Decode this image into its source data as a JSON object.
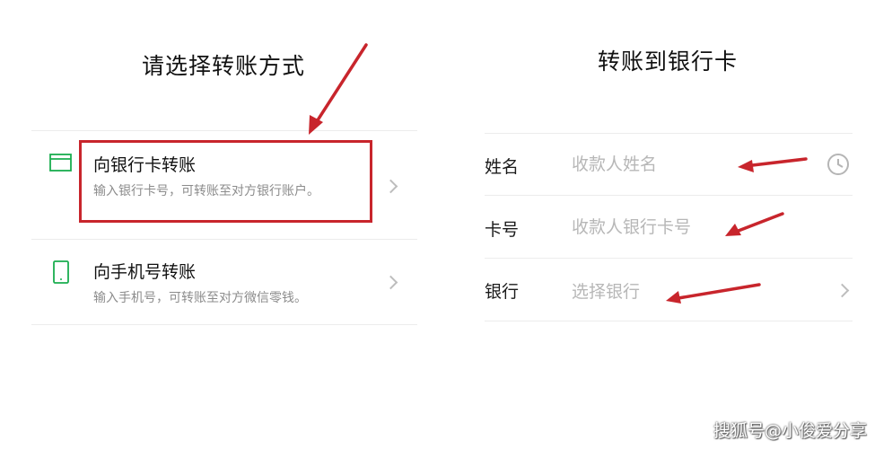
{
  "left_panel": {
    "title": "请选择转账方式",
    "options": [
      {
        "title": "向银行卡转账",
        "description": "输入银行卡号，可转账至对方银行账户。",
        "icon": "bank-card-icon"
      },
      {
        "title": "向手机号转账",
        "description": "输入手机号，可转账至对方微信零钱。",
        "icon": "phone-icon"
      }
    ]
  },
  "right_panel": {
    "title": "转账到银行卡",
    "fields": [
      {
        "label": "姓名",
        "placeholder": "收款人姓名",
        "trailing_icon": "clock-icon"
      },
      {
        "label": "卡号",
        "placeholder": "收款人银行卡号"
      },
      {
        "label": "银行",
        "placeholder": "选择银行",
        "trailing_icon": "chevron-right-icon"
      }
    ]
  },
  "watermark": "搜狐号@小俊爱分享",
  "colors": {
    "accent_green": "#1aad4f",
    "annotation_red": "#c8252c",
    "placeholder_gray": "#b7b7b7"
  }
}
